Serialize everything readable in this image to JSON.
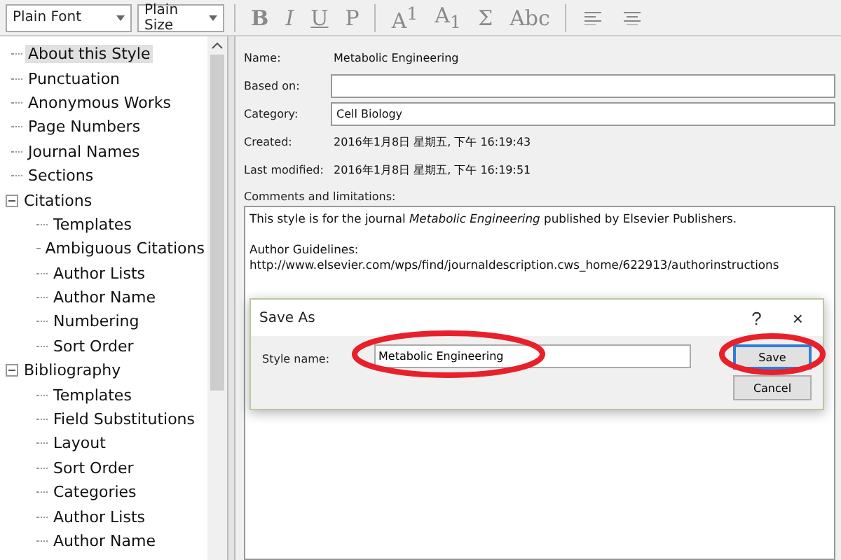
{
  "toolbar": {
    "font_select": "Plain Font",
    "size_select": "Plain Size",
    "format_buttons": [
      {
        "label": "B",
        "kind": "bold"
      },
      {
        "label": "I",
        "kind": "italic"
      },
      {
        "label": "U",
        "kind": "underline"
      },
      {
        "label": "P",
        "kind": "plain"
      },
      {
        "label": "A$^{1}$",
        "kind": "text"
      },
      {
        "label": "A$_{1}$",
        "kind": "text"
      },
      {
        "label": "Σ",
        "kind": "text"
      },
      {
        "label": "Abc",
        "kind": "text"
      }
    ]
  },
  "tree": [
    {
      "label": "About this Style",
      "selected": true
    },
    {
      "label": "Punctuation",
      "selected": false
    },
    {
      "label": "Anonymous Works",
      "selected": false
    },
    {
      "label": "Page Numbers",
      "selected": false
    },
    {
      "label": "Journal Names",
      "selected": false
    },
    {
      "label": "Sections",
      "selected": false
    },
    {
      "label": "Citations",
      "selected": false,
      "expanded": true,
      "children": [
        {
          "label": "Templates",
          "selected": false
        },
        {
          "label": "Ambiguous Citations",
          "selected": false
        },
        {
          "label": "Author Lists",
          "selected": false
        },
        {
          "label": "Author Name",
          "selected": false
        },
        {
          "label": "Numbering",
          "selected": false
        },
        {
          "label": "Sort Order",
          "selected": false
        }
      ]
    },
    {
      "label": "Bibliography",
      "selected": false,
      "expanded": true,
      "children": [
        {
          "label": "Templates",
          "selected": false
        },
        {
          "label": "Field Substitutions",
          "selected": false
        },
        {
          "label": "Layout",
          "selected": false
        },
        {
          "label": "Sort Order",
          "selected": false
        },
        {
          "label": "Categories",
          "selected": false
        },
        {
          "label": "Author Lists",
          "selected": false
        },
        {
          "label": "Author Name",
          "selected": false
        }
      ]
    }
  ],
  "fields": [
    {
      "label": "Name:",
      "value": "Metabolic Engineering",
      "kind": "text"
    },
    {
      "label": "Based on:",
      "kind": "input"
    },
    {
      "label": "Category:",
      "value": "Cell Biology",
      "kind": "input"
    },
    {
      "label": "Created:",
      "value": "2016年1月8日 星期五, 下午 16:19:43",
      "kind": "text"
    },
    {
      "label": "Last modified:",
      "value": "2016年1月8日 星期五, 下午 16:19:51",
      "kind": "text"
    }
  ],
  "comments": {
    "label": "Comments and limitations:",
    "lines": [
      "This style is for the journal *Metabolic Engineering*  published by Elsevier Publishers.",
      "Author Guidelines:",
      "http://www.elsevier.com/wps/find/journaldescription.cws_home/622913/authorinstructions"
    ]
  },
  "dialog": {
    "title": "Save As",
    "help": "?",
    "close": "×",
    "field_label": "Style name:",
    "field_value": "Metabolic Engineering",
    "buttons": [
      {
        "label": "Save",
        "default": true
      },
      {
        "label": "Cancel",
        "default": false
      }
    ]
  }
}
